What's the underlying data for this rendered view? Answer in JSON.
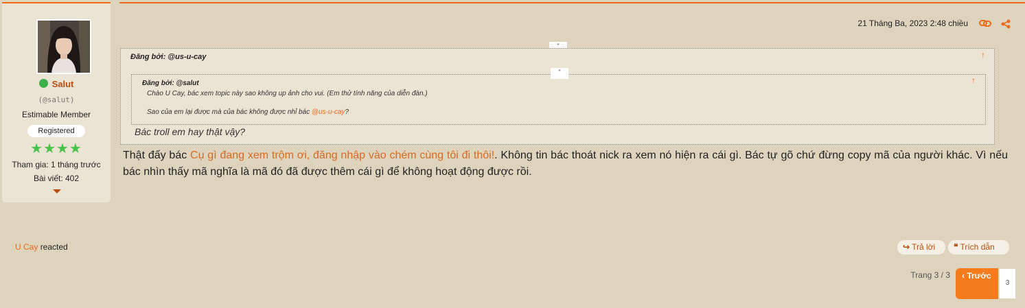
{
  "user": {
    "name": "Salut",
    "handle": "(@salut)",
    "title": "Estimable Member",
    "badge": "Registered",
    "stars": "★★★★",
    "joined": "Tham gia: 1 tháng trước",
    "posts": "Bài viết: 402",
    "online_color": "#3db24b"
  },
  "post": {
    "timestamp": "21 Tháng Ba, 2023 2:48 chiều",
    "icons": [
      "link-icon",
      "share-icon"
    ],
    "quote_outer": {
      "author": "Đăng bởi: @us-u-cay",
      "mark": "\"",
      "arrow": "↑",
      "reply": "Bác troll em hay thật vậy?"
    },
    "quote_inner": {
      "author": "Đăng bởi: @salut",
      "mark": "\"",
      "arrow": "↑",
      "line1": "Chào U Cay, bác xem topic này sao không up ảnh cho vui. (Em thử tính năng của diễn đàn.)",
      "line2_prefix": "Sao của em lại được mà của bác không được nhỉ bác ",
      "line2_mention": "@us-u-cay",
      "line2_suffix": "?"
    },
    "body_prefix": "Thật đấy bác ",
    "body_highlight": "Cụ gì đang xem trộm ơi, đăng nhập vào chém cùng tôi đi thôi!",
    "body_suffix": ". Không tin bác thoát nick ra xem nó hiện ra cái gì. Bác tự gõ chứ đừng copy mã của người khác. Vì nếu bác nhìn thấy mã nghĩa là mã đó đã được thêm cái gì để không hoạt động được rồi."
  },
  "footer": {
    "reacted_user": "U Cay",
    "reacted_text": "reacted",
    "reply_label": "Trả lời",
    "quote_label": "Trích dẫn"
  },
  "pagination": {
    "label": "Trang 3 / 3",
    "prev_label": "Trước",
    "page": "3"
  },
  "colors": {
    "accent": "#ec6a1a",
    "background": "#ded3bd",
    "card": "#ebe3d4",
    "star": "#49c24a"
  }
}
